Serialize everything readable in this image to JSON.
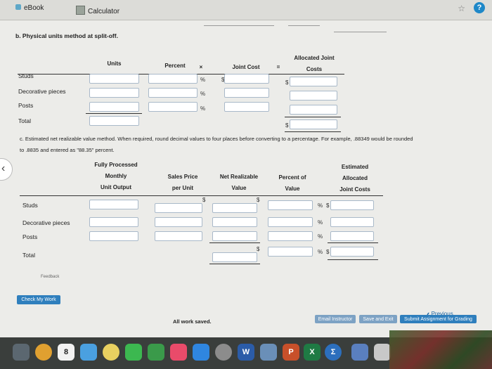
{
  "browser": {
    "tab_ebook": "eBook",
    "tab_calculator": "Calculator",
    "star_icon": "☆",
    "help_icon": "?"
  },
  "part_b": {
    "title": "b. Physical units method at split-off.",
    "headers": {
      "units": "Units",
      "percent": "Percent",
      "times": "×",
      "joint_cost": "Joint Cost",
      "equals": "=",
      "allocated_line1": "Allocated Joint",
      "allocated_line2": "Costs"
    },
    "rows": [
      "Studs",
      "Decorative pieces",
      "Posts",
      "Total"
    ],
    "symbols": {
      "pct": "%",
      "dollar": "$"
    }
  },
  "part_c": {
    "instruction": "c. Estimated net realizable value method. When required, round decimal values to four places before converting to a percentage. For example, .88349 would be rounded",
    "instruction_line2": "to .8835 and entered as \"88.35\" percent.",
    "headers": {
      "fully_1": "Fully Processed",
      "fully_2": "Monthly",
      "fully_3": "Unit Output",
      "sales_1": "Sales Price",
      "sales_2": "per Unit",
      "nrv_1": "Net Realizable",
      "nrv_2": "Value",
      "pct_1": "Percent of",
      "pct_2": "Value",
      "est_1": "Estimated",
      "est_2": "Allocated",
      "est_3": "Joint Costs"
    },
    "rows": [
      "Studs",
      "Decorative pieces",
      "Posts",
      "Total"
    ]
  },
  "footer": {
    "feedback": "Feedback",
    "check_my_work": "Check My Work",
    "previous": "Previous",
    "all_work_saved": "All work saved.",
    "email_instructor": "Email Instructor",
    "save_and_exit": "Save and Exit",
    "submit": "Submit Assignment for Grading"
  },
  "dock": {
    "icons": [
      "launchpad-icon",
      "chrome-icon",
      "calendar-icon",
      "finder-icon",
      "photos-icon",
      "messages-icon",
      "facetime-icon",
      "music-icon",
      "appstore-icon",
      "settings-icon",
      "word-icon",
      "preview-icon",
      "powerpoint-icon",
      "excel-icon",
      "equation-icon",
      "calculator-icon",
      "trash-icon"
    ],
    "calendar_day": "8",
    "word_letter": "W",
    "powerpoint_letter": "P",
    "excel_letter": "X",
    "sigma": "Σ"
  }
}
